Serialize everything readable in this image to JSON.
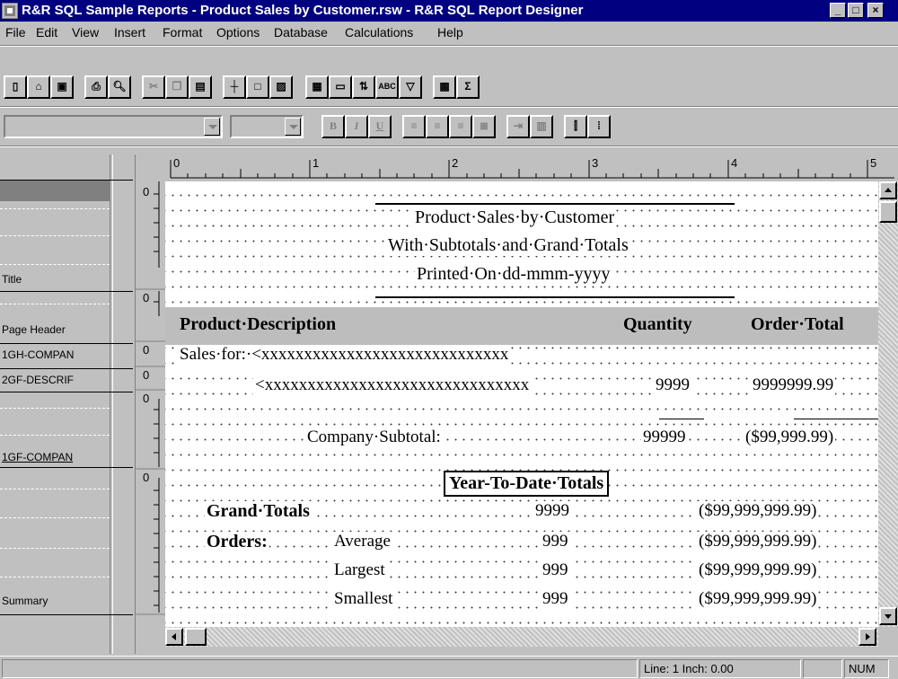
{
  "window": {
    "title": "R&R SQL Sample Reports - Product Sales by Customer.rsw - R&R SQL Report Designer",
    "min_label": "_",
    "max_label": "□",
    "close_label": "×"
  },
  "menu": [
    "File",
    "Edit",
    "View",
    "Insert",
    "Format",
    "Options",
    "Database",
    "Calculations",
    "Help"
  ],
  "toolbar_format": {
    "bold": "B",
    "italic": "I",
    "underline": "U"
  },
  "ruler": {
    "marks": [
      "0",
      "1",
      "2",
      "3",
      "4",
      "5"
    ]
  },
  "bands": [
    {
      "label": "Title"
    },
    {
      "label": "Page Header"
    },
    {
      "label": "1GH-COMPAN"
    },
    {
      "label": "2GF-DESCRIF"
    },
    {
      "label": "1GF-COMPAN"
    },
    {
      "label": "Summary"
    }
  ],
  "vruler_zero": "0",
  "report": {
    "title1": "Product·Sales·by·Customer",
    "title2": "With·Subtotals·and·Grand·Totals",
    "title3": "Printed·On·dd-mmm-yyyy",
    "hdr_desc": "Product·Description",
    "hdr_qty": "Quantity",
    "hdr_total": "Order·Total",
    "sales_for": "Sales·for:·<xxxxxxxxxxxxxxxxxxxxxxxxxxxxx",
    "desc_field": "<xxxxxxxxxxxxxxxxxxxxxxxxxxxxxxx",
    "qty_field": "9999",
    "total_field": "9999999.99",
    "company_subtotal": "Company·Subtotal:",
    "sub_qty": "99999",
    "sub_total": "($99,999.99)",
    "ytd": "Year-To-Date·Totals",
    "grand_totals": "Grand·Totals",
    "grand_qty": "9999",
    "grand_amt": "($99,999,999.99)",
    "orders": "Orders:",
    "avg": "Average",
    "avg_qty": "999",
    "avg_amt": "($99,999,999.99)",
    "largest": "Largest",
    "largest_qty": "999",
    "largest_amt": "($99,999,999.99)",
    "smallest": "Smallest",
    "smallest_qty": "999",
    "smallest_amt": "($99,999,999.99)"
  },
  "status": {
    "line": "Line:  1  Inch: 0.00",
    "num": "NUM"
  }
}
